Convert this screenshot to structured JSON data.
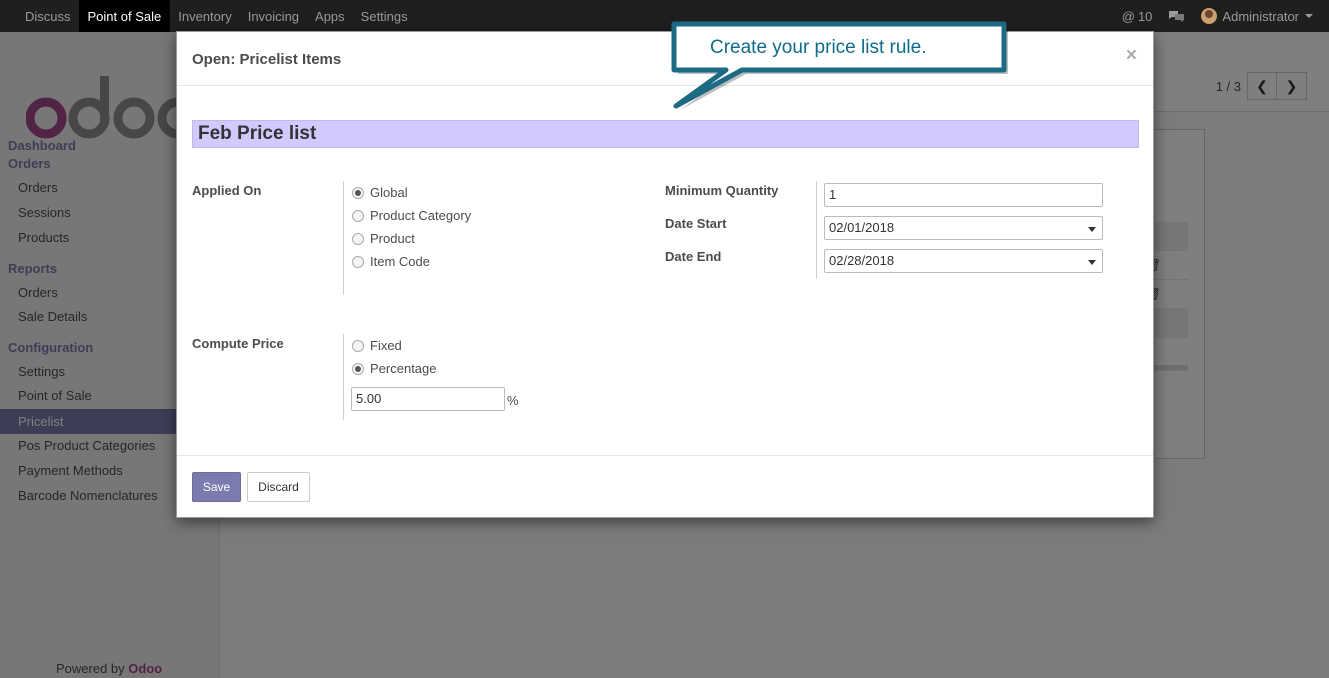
{
  "navbar": {
    "items": [
      "Discuss",
      "Point of Sale",
      "Inventory",
      "Invoicing",
      "Apps",
      "Settings"
    ],
    "active_index": 1,
    "mentions_count": "10",
    "user": "Administrator"
  },
  "sidebar": {
    "logo_text": "odoo",
    "sections": {
      "dashboard": "Dashboard",
      "orders": "Orders",
      "reports": "Reports",
      "configuration": "Configuration"
    },
    "orders_items": [
      "Orders",
      "Sessions",
      "Products"
    ],
    "reports_items": [
      "Orders",
      "Sale Details"
    ],
    "config_items": [
      "Settings",
      "Point of Sale",
      "Pricelist",
      "Pos Product Categories",
      "Payment Methods",
      "Barcode Nomenclatures"
    ],
    "active_item": "Pricelist",
    "powered_prefix": "Powered by",
    "powered_brand": "Odoo"
  },
  "pager": {
    "text": "1 / 3"
  },
  "modal": {
    "title": "Open: Pricelist Items",
    "close": "×",
    "name": "Feb Price list",
    "applied_on": {
      "label": "Applied On",
      "options": [
        "Global",
        "Product Category",
        "Product",
        "Item Code"
      ],
      "selected": "Global"
    },
    "min_qty": {
      "label": "Minimum Quantity",
      "value": "1"
    },
    "date_start": {
      "label": "Date Start",
      "value": "02/01/2018"
    },
    "date_end": {
      "label": "Date End",
      "value": "02/28/2018"
    },
    "compute_price": {
      "label": "Compute Price",
      "options": [
        "Fixed",
        "Percentage"
      ],
      "selected": "Percentage",
      "percentage_value": "5.00",
      "unit": "%"
    },
    "buttons": {
      "save": "Save",
      "discard": "Discard"
    }
  },
  "tooltip": {
    "text": "Create your price list rule."
  },
  "colors": {
    "brand": "#7c7bad",
    "name_field_bg": "#d2c9ff",
    "callout_border": "#1d6a84",
    "callout_text": "#0e6b8a"
  }
}
